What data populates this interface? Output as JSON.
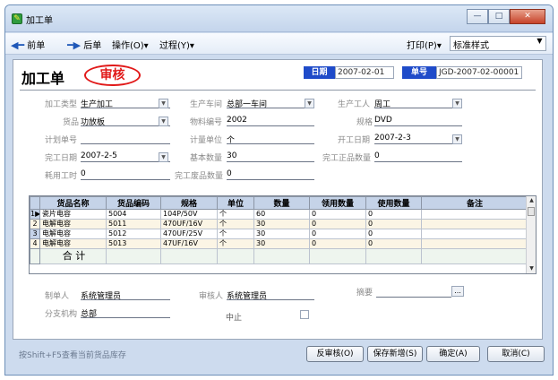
{
  "window": {
    "title": "加工单",
    "app_icon": "app-icon",
    "controls": {
      "minimize": "—",
      "maximize": "□",
      "close": "✕"
    }
  },
  "toolbar": {
    "prev": "前单",
    "next": "后单",
    "operate": "操作(O)▾",
    "process": "过程(Y)▾",
    "print": "打印(P)▾",
    "style_value": "标准样式"
  },
  "header": {
    "title": "加工单",
    "stamp": "审核",
    "date_label": "日期",
    "date_value": "2007-02-01",
    "no_label": "单号",
    "no_value": "JGD-2007-02-00001"
  },
  "form": {
    "type_label": "加工类型",
    "type_value": "生产加工",
    "workshop_label": "生产车间",
    "workshop_value": "总部一车间",
    "worker_label": "生产工人",
    "worker_value": "周工",
    "product_label": "货品",
    "product_value": "功放板",
    "code_label": "物料编号",
    "code_value": "2002",
    "spec_label": "规格",
    "spec_value": "DVD",
    "plan_label": "计划单号",
    "plan_value": "",
    "unit_label": "计量单位",
    "unit_value": "个",
    "start_label": "开工日期",
    "start_value": "2007-2-3",
    "done_label": "完工日期",
    "done_value": "2007-2-5",
    "base_label": "基本数量",
    "base_value": "30",
    "finished_label": "完工正品数量",
    "finished_value": "0",
    "hours_label": "耗用工时",
    "hours_value": "0",
    "waste_label": "完工废品数量",
    "waste_value": "0"
  },
  "grid": {
    "columns": [
      "货品名称",
      "货品编码",
      "规格",
      "单位",
      "数量",
      "领用数量",
      "使用数量",
      "备注"
    ],
    "rows": [
      [
        "瓷片电容",
        "5004",
        "104P/50V",
        "个",
        "60",
        "0",
        "0",
        ""
      ],
      [
        "电解电容",
        "5011",
        "470UF/16V",
        "个",
        "30",
        "0",
        "0",
        ""
      ],
      [
        "电解电容",
        "5012",
        "470UF/25V",
        "个",
        "30",
        "0",
        "0",
        ""
      ],
      [
        "电解电容",
        "5013",
        "47UF/16V",
        "个",
        "30",
        "0",
        "0",
        ""
      ]
    ],
    "row_numbers": [
      "1",
      "2",
      "3",
      "4"
    ],
    "current_row_marker": "▶",
    "total_label": "合 计"
  },
  "footer": {
    "maker_label": "制单人",
    "maker_value": "系统管理员",
    "auditor_label": "审核人",
    "auditor_value": "系统管理员",
    "summary_label": "摘要",
    "summary_value": "",
    "ellipsis": "...",
    "branch_label": "分支机构",
    "branch_value": "总部",
    "stop_label": "中止"
  },
  "status": {
    "hint": "按Shift+F5查看当前货品库存"
  },
  "buttons": {
    "unaudit": "反审核(O)",
    "save_new": "保存新增(S)",
    "ok": "确定(A)",
    "cancel": "取消(C)"
  },
  "colors": {
    "accent_blue": "#1f4bc9",
    "stamp_red": "#e11919",
    "grid_header": "#c5d3e8"
  }
}
